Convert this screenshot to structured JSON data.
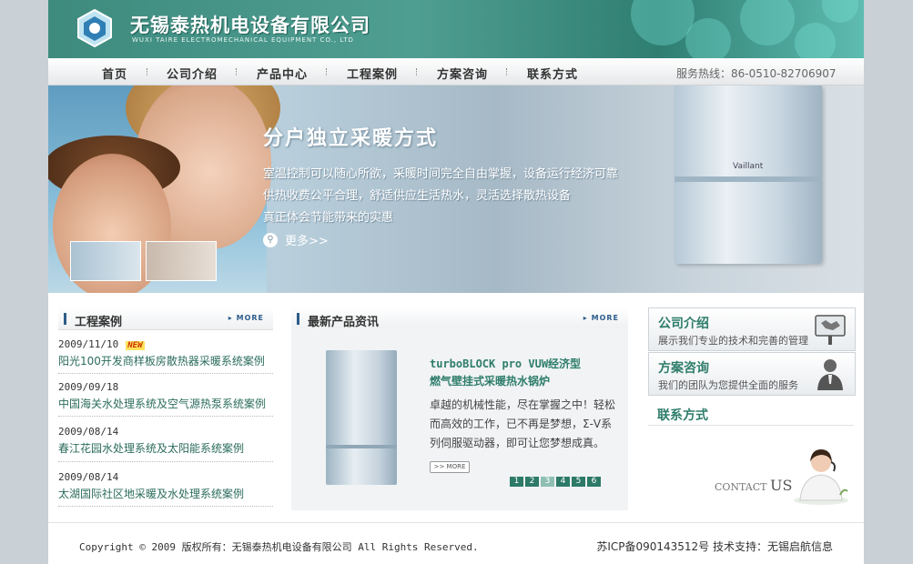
{
  "header": {
    "brand_cn": "无锡泰热机电设备有限公司",
    "brand_en": "WUXI TAIRE ELECTROMECHANICAL EQUIPMENT CO., LTD",
    "logo_icon": "company-logo-icon",
    "accent_color": "#3e8b7e"
  },
  "nav": {
    "items": [
      "首页",
      "公司介绍",
      "产品中心",
      "工程案例",
      "方案咨询",
      "联系方式"
    ],
    "hotline": "服务热线：86-0510-82706907"
  },
  "banner": {
    "title": "分户独立采暖方式",
    "lines": [
      "室温控制可以随心所欲，采暖时间完全自由掌握，设备运行经济可靠",
      "供热收费公平合理，舒适供应生活热水，灵活选择散热设备",
      "真正体会节能带来的实惠"
    ],
    "more_label": "更多>>",
    "boiler_brand": "Vaillant"
  },
  "cases": {
    "title": "工程案例",
    "more_label": "MORE",
    "items": [
      {
        "date": "2009/11/10",
        "badge": "NEW",
        "title": "阳光100开发商样板房散热器采暖系统案例"
      },
      {
        "date": "2009/09/18",
        "badge": "",
        "title": "中国海关水处理系统及空气源热泵系统案例"
      },
      {
        "date": "2009/08/14",
        "badge": "",
        "title": "春江花园水处理系统及太阳能系统案例"
      },
      {
        "date": "2009/08/14",
        "badge": "",
        "title": "太湖国际社区地采暖及水处理系统案例"
      }
    ]
  },
  "products": {
    "title": "最新产品资讯",
    "more_label": "MORE",
    "product_title_1": "turboBLOCK pro VUW经济型",
    "product_title_2": "燃气壁挂式采暖热水锅炉",
    "description": "卓越的机械性能，尽在掌握之中！轻松而高效的工作，已不再是梦想，Σ-V系列伺服驱动器，即可让您梦想成真。",
    "detail_label": ">> MORE",
    "pages": [
      "1",
      "2",
      "3",
      "4",
      "5",
      "6"
    ],
    "active_page": "3"
  },
  "sidebar": {
    "about_title": "公司介绍",
    "about_desc": "展示我们专业的技术和完善的管理",
    "plan_title": "方案咨询",
    "plan_desc": "我们的团队为您提供全面的服务",
    "contact_title": "联系方式",
    "contact_us_1": "CONTACT",
    "contact_us_2": "US"
  },
  "footer": {
    "copyright": "Copyright © 2009 版权所有：无锡泰热机电设备有限公司 All Rights Reserved.",
    "icp": "苏ICP备090143512号 技术支持：无锡启航信息"
  }
}
